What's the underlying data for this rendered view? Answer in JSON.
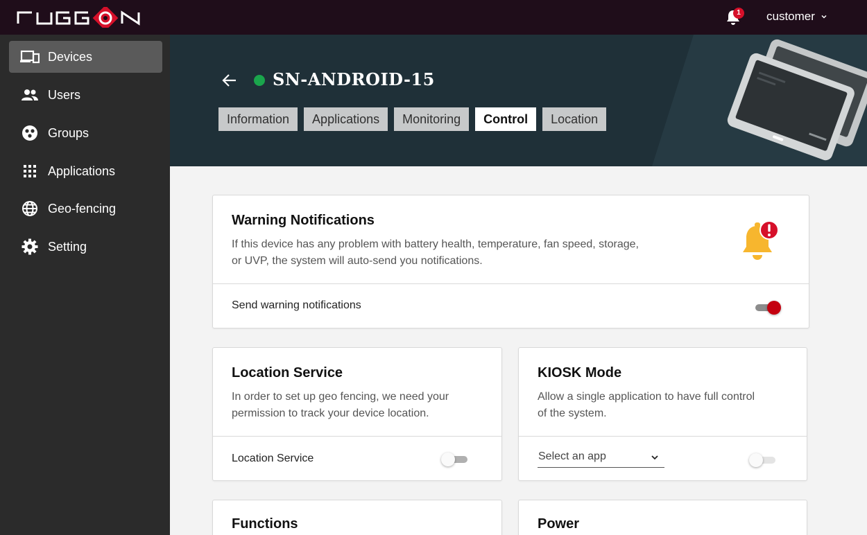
{
  "brand": {
    "logo_text": "RUGGON",
    "accent": "#d6102a"
  },
  "topbar": {
    "notification_count": "1",
    "user_name": "customer"
  },
  "sidebar": {
    "items": [
      {
        "label": "Devices",
        "icon": "devices-icon",
        "active": true
      },
      {
        "label": "Users",
        "icon": "users-icon"
      },
      {
        "label": "Groups",
        "icon": "groups-icon"
      },
      {
        "label": "Applications",
        "icon": "applications-icon"
      },
      {
        "label": "Geo-fencing",
        "icon": "globe-icon"
      },
      {
        "label": "Setting",
        "icon": "gear-icon"
      }
    ]
  },
  "header": {
    "device_name": "SN-ANDROID-15",
    "status_color": "#1aa54c",
    "tabs": [
      {
        "label": "Information"
      },
      {
        "label": "Applications"
      },
      {
        "label": "Monitoring"
      },
      {
        "label": "Control",
        "active": true
      },
      {
        "label": "Location"
      }
    ]
  },
  "warning_card": {
    "title": "Warning Notifications",
    "desc_line1": "If this device has any problem with battery health, temperature, fan speed, storage,",
    "desc_line2": "or UVP, the system will auto-send you notifications.",
    "row_label": "Send warning notifications",
    "toggle_on": true
  },
  "location_card": {
    "title": "Location Service",
    "desc_line1": "In order to set up geo fencing, we need your",
    "desc_line2": "permission to track your device location.",
    "row_label": "Location Service",
    "toggle_on": false
  },
  "kiosk_card": {
    "title": "KIOSK Mode",
    "desc_line1": "Allow a single application to have full control",
    "desc_line2": "of the system.",
    "select_value": "Select an app",
    "toggle_on": false
  },
  "functions_card": {
    "title": "Functions"
  },
  "power_card": {
    "title": "Power"
  }
}
